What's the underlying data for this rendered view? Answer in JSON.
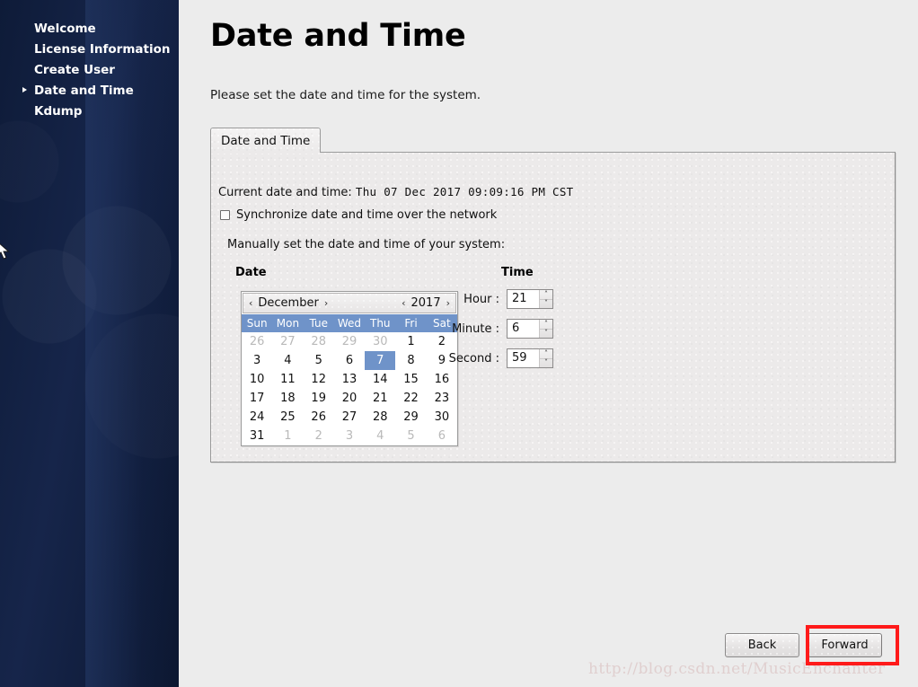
{
  "sidebar": {
    "items": [
      {
        "label": "Welcome",
        "active": false
      },
      {
        "label": "License Information",
        "active": false
      },
      {
        "label": "Create User",
        "active": false
      },
      {
        "label": "Date and Time",
        "active": true
      },
      {
        "label": "Kdump",
        "active": false
      }
    ]
  },
  "page": {
    "title": "Date and Time",
    "subtitle": "Please set the date and time for the system."
  },
  "tab": {
    "label": "Date and Time"
  },
  "panel": {
    "current_label": "Current date and time:",
    "current_value": "Thu 07 Dec 2017 09:09:16 PM CST",
    "sync_label": "Synchronize date and time over the network",
    "sync_checked": false,
    "manual_label": "Manually set the date and time of your system:",
    "date_section_label": "Date",
    "time_section_label": "Time"
  },
  "calendar": {
    "prev_month_icon": "‹",
    "next_month_icon": "›",
    "prev_year_icon": "‹",
    "next_year_icon": "›",
    "month": "December",
    "year": "2017",
    "weekdays": [
      "Sun",
      "Mon",
      "Tue",
      "Wed",
      "Thu",
      "Fri",
      "Sat"
    ],
    "header_color": "#6f93c9",
    "selected_day": 7,
    "weeks": [
      [
        {
          "d": "26",
          "dim": true
        },
        {
          "d": "27",
          "dim": true
        },
        {
          "d": "28",
          "dim": true
        },
        {
          "d": "29",
          "dim": true
        },
        {
          "d": "30",
          "dim": true
        },
        {
          "d": "1",
          "dim": false
        },
        {
          "d": "2",
          "dim": false
        }
      ],
      [
        {
          "d": "3",
          "dim": false
        },
        {
          "d": "4",
          "dim": false
        },
        {
          "d": "5",
          "dim": false
        },
        {
          "d": "6",
          "dim": false
        },
        {
          "d": "7",
          "dim": false,
          "sel": true
        },
        {
          "d": "8",
          "dim": false
        },
        {
          "d": "9",
          "dim": false
        }
      ],
      [
        {
          "d": "10",
          "dim": false
        },
        {
          "d": "11",
          "dim": false
        },
        {
          "d": "12",
          "dim": false
        },
        {
          "d": "13",
          "dim": false
        },
        {
          "d": "14",
          "dim": false
        },
        {
          "d": "15",
          "dim": false
        },
        {
          "d": "16",
          "dim": false
        }
      ],
      [
        {
          "d": "17",
          "dim": false
        },
        {
          "d": "18",
          "dim": false
        },
        {
          "d": "19",
          "dim": false
        },
        {
          "d": "20",
          "dim": false
        },
        {
          "d": "21",
          "dim": false
        },
        {
          "d": "22",
          "dim": false
        },
        {
          "d": "23",
          "dim": false
        }
      ],
      [
        {
          "d": "24",
          "dim": false
        },
        {
          "d": "25",
          "dim": false
        },
        {
          "d": "26",
          "dim": false
        },
        {
          "d": "27",
          "dim": false
        },
        {
          "d": "28",
          "dim": false
        },
        {
          "d": "29",
          "dim": false
        },
        {
          "d": "30",
          "dim": false
        }
      ],
      [
        {
          "d": "31",
          "dim": false
        },
        {
          "d": "1",
          "dim": true
        },
        {
          "d": "2",
          "dim": true
        },
        {
          "d": "3",
          "dim": true
        },
        {
          "d": "4",
          "dim": true
        },
        {
          "d": "5",
          "dim": true
        },
        {
          "d": "6",
          "dim": true
        }
      ]
    ]
  },
  "time": {
    "hour_label": "Hour :",
    "hour_value": "21",
    "minute_label": "Minute :",
    "minute_value": "6",
    "second_label": "Second :",
    "second_value": "59",
    "spin_up_icon": "˄",
    "spin_down_icon": "˅"
  },
  "footer": {
    "back_label": "Back",
    "forward_label": "Forward",
    "highlight_color": "#ff1a1a"
  },
  "watermark": {
    "text": "http://blog.csdn.net/MusicEnchanter"
  }
}
